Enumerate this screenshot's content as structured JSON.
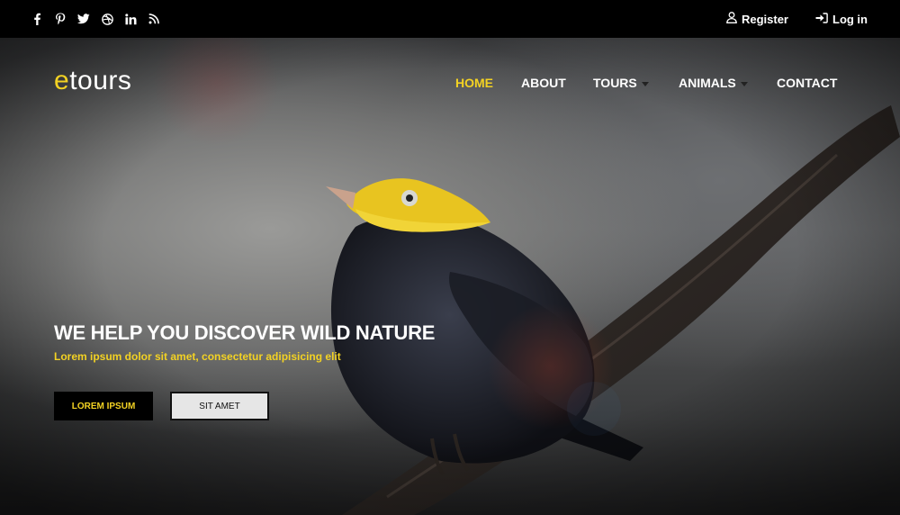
{
  "topbar": {
    "social_icons": [
      "facebook-icon",
      "pinterest-icon",
      "twitter-icon",
      "dribbble-icon",
      "linkedin-icon",
      "rss-icon"
    ],
    "register_label": "Register",
    "login_label": "Log in"
  },
  "brand": {
    "logo_first": "e",
    "logo_rest": "tours",
    "accent_color": "#f3d223"
  },
  "nav": {
    "home": "HOME",
    "about": "ABOUT",
    "tours": "TOURS",
    "animals": "ANIMALS",
    "contact": "CONTACT"
  },
  "hero": {
    "headline": "WE HELP YOU DISCOVER WILD NATURE",
    "subline": "Lorem ipsum dolor sit amet, consectetur adipisicing elit",
    "primary_button": "LOREM IPSUM",
    "secondary_button": "SIT AMET"
  }
}
